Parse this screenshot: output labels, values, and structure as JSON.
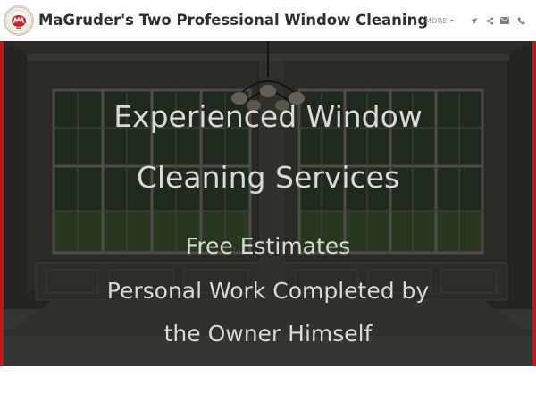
{
  "header": {
    "site_title": "MaGruder's Two Professional Window Cleaning",
    "logo_icon": "window-cleaning-logo",
    "nav": {
      "more_label": "MORE",
      "icons": [
        "location-arrow-icon",
        "share-icon",
        "envelope-icon",
        "phone-icon"
      ]
    }
  },
  "hero": {
    "headline_line1": "Experienced Window",
    "headline_line2": "Cleaning Services",
    "sub_line1": "Free Estimates",
    "sub_line2": "Personal Work Completed by",
    "sub_line3": "the Owner Himself",
    "accent_color": "#b21c1c",
    "text_color": "#d9d9d6"
  }
}
